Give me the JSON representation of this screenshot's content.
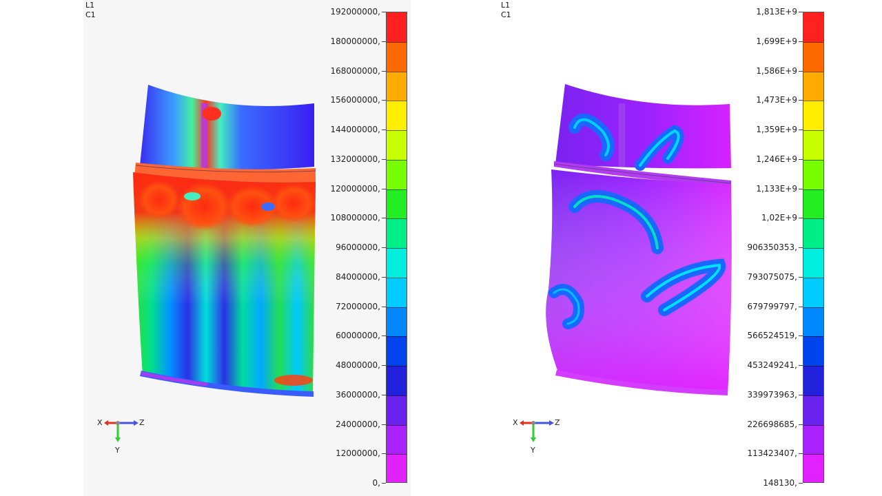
{
  "viewports": [
    {
      "id": "left",
      "corner_labels": [
        "L1",
        "C1"
      ],
      "scale_labels": [
        "192000000,",
        "180000000,",
        "168000000,",
        "156000000,",
        "144000000,",
        "132000000,",
        "120000000,",
        "108000000,",
        "96000000,",
        "84000000,",
        "72000000,",
        "60000000,",
        "48000000,",
        "36000000,",
        "24000000,",
        "12000000,",
        "0,"
      ],
      "triad": {
        "x": "X",
        "z": "Z",
        "y": "Y"
      }
    },
    {
      "id": "right",
      "corner_labels": [
        "L1",
        "C1"
      ],
      "scale_labels": [
        "1,813E+9",
        "1,699E+9",
        "1,586E+9",
        "1,473E+9",
        "1,359E+9",
        "1,246E+9",
        "1,133E+9",
        "1,02E+9",
        "906350353,",
        "793075075,",
        "679799797,",
        "566524519,",
        "453249241,",
        "339973963,",
        "226698685,",
        "113423407,",
        "148130,"
      ],
      "triad": {
        "x": "X",
        "z": "Z",
        "y": "Y"
      }
    }
  ],
  "colors": {
    "scale_bands_top_to_bottom": [
      "#ff2020",
      "#ff6a00",
      "#ffaa00",
      "#ffee00",
      "#c8ff00",
      "#77ff00",
      "#22ee22",
      "#00ee88",
      "#00eedd",
      "#00ccff",
      "#0088ff",
      "#0044ee",
      "#2222dd",
      "#6a22ee",
      "#aa22ff",
      "#e122ff"
    ],
    "triad_x": "#dd3322",
    "triad_y": "#33cc33",
    "triad_z": "#4455dd"
  }
}
